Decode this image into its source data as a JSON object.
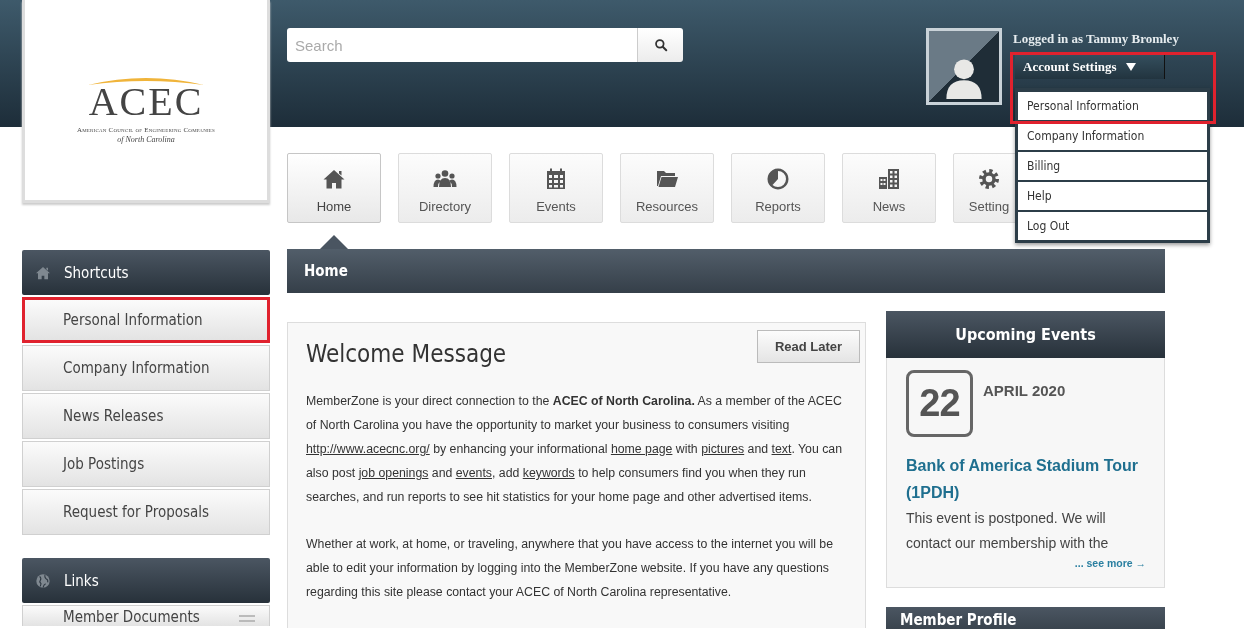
{
  "logo": {
    "mark": "ACEC",
    "name": "American Council of Engineering Companies",
    "region": "of North Carolina"
  },
  "search": {
    "placeholder": "Search"
  },
  "user": {
    "logged_in": "Logged in as Tammy Bromley",
    "account_button": "Account Settings",
    "expanded": true,
    "highlighted": true,
    "menu": [
      {
        "label": "Personal Information"
      },
      {
        "label": "Company Information"
      },
      {
        "label": "Billing"
      },
      {
        "label": "Help"
      },
      {
        "label": "Log Out"
      }
    ]
  },
  "nav": [
    {
      "label": "Home",
      "kind": "home",
      "selected": true
    },
    {
      "label": "Directory",
      "kind": "people",
      "selected": false
    },
    {
      "label": "Events",
      "kind": "calendar",
      "selected": false
    },
    {
      "label": "Resources",
      "kind": "folder",
      "selected": false
    },
    {
      "label": "Reports",
      "kind": "pie",
      "selected": false
    },
    {
      "label": "News",
      "kind": "buildings",
      "selected": false
    },
    {
      "label": "Setting",
      "kind": "gear",
      "selected": false
    }
  ],
  "page_title": "Home",
  "sidebar": [
    {
      "title": "Shortcuts",
      "kind": "home",
      "items": [
        {
          "label": "Personal Information",
          "highlighted": true
        },
        {
          "label": "Company Information",
          "highlighted": false
        },
        {
          "label": "News Releases",
          "highlighted": false
        },
        {
          "label": "Job Postings",
          "highlighted": false
        },
        {
          "label": "Request for Proposals",
          "highlighted": false
        }
      ]
    },
    {
      "title": "Links",
      "kind": "globe",
      "items": [
        {
          "label": "Member Documents",
          "highlighted": false
        }
      ]
    }
  ],
  "welcome": {
    "title": "Welcome Message",
    "button": "Read Later",
    "paragraphs": [
      [
        {
          "kind": "plain",
          "text": "MemberZone is your direct connection to the "
        },
        {
          "kind": "bold",
          "text": "ACEC of North Carolina."
        },
        {
          "kind": "plain",
          "text": " As a member of the ACEC of North Carolina you have the opportunity to market your business to consumers visiting "
        },
        {
          "kind": "link",
          "text": "http://www.acecnc.org/"
        },
        {
          "kind": "plain",
          "text": " by enhancing your informational "
        },
        {
          "kind": "link",
          "text": "home page"
        },
        {
          "kind": "plain",
          "text": " with "
        },
        {
          "kind": "link",
          "text": "pictures"
        },
        {
          "kind": "plain",
          "text": " and "
        },
        {
          "kind": "link",
          "text": "text"
        },
        {
          "kind": "plain",
          "text": ". You can also post "
        },
        {
          "kind": "link",
          "text": "job openings"
        },
        {
          "kind": "plain",
          "text": " and "
        },
        {
          "kind": "link",
          "text": "events"
        },
        {
          "kind": "plain",
          "text": ", add "
        },
        {
          "kind": "link",
          "text": "keywords"
        },
        {
          "kind": "plain",
          "text": " to help consumers find you when they run searches, and run reports to see hit statistics for your home page and other advertised items."
        }
      ],
      [
        {
          "kind": "plain",
          "text": "Whether at work, at home, or traveling, anywhere that you have access to the internet you will be able to edit your information by logging into the MemberZone website. If you have any questions regarding this site please contact your ACEC of North Carolina representative."
        }
      ]
    ]
  },
  "events": {
    "title": "Upcoming Events",
    "items": [
      {
        "day": "22",
        "month_year": "APRIL 2020",
        "title": "Bank of America Stadium Tour (1PDH)",
        "description": "This event is postponed. We will contact our membership with the",
        "more": "... see more →"
      }
    ]
  },
  "member_profile": {
    "title": "Member Profile"
  }
}
